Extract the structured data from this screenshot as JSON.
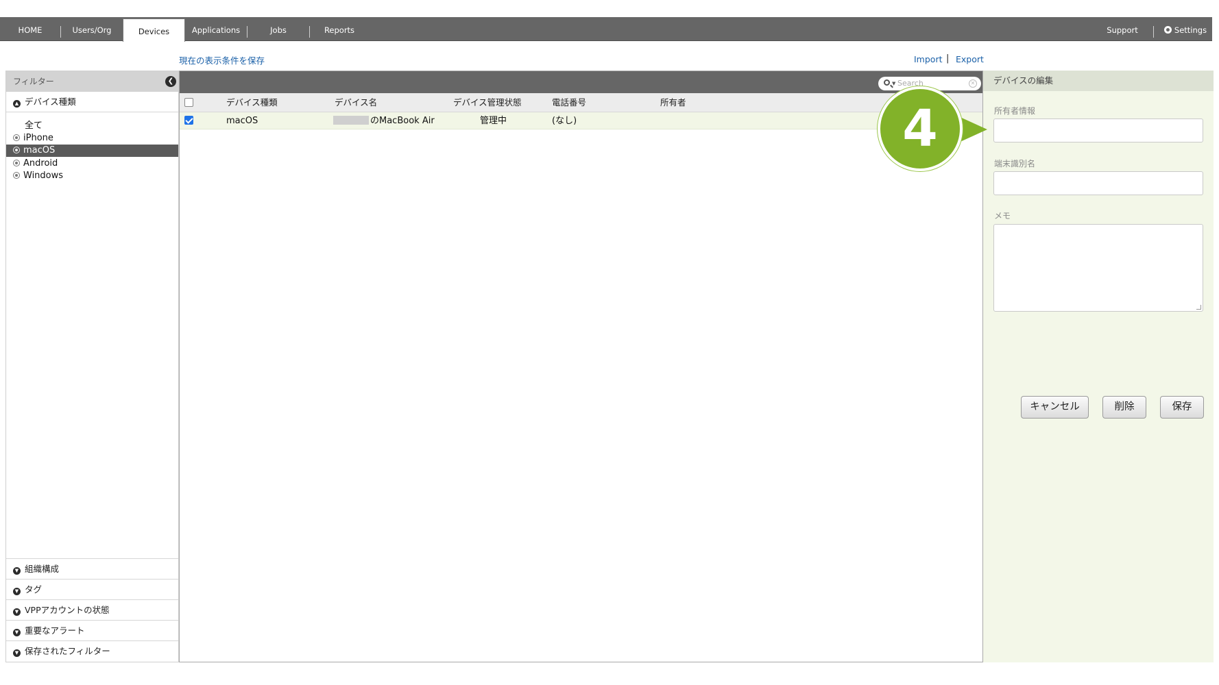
{
  "nav": {
    "items": [
      {
        "label": "HOME"
      },
      {
        "label": "Users/Org"
      },
      {
        "label": "Devices",
        "active": true
      },
      {
        "label": "Applications"
      },
      {
        "label": "Jobs"
      },
      {
        "label": "Reports"
      }
    ],
    "support": "Support",
    "settings": "Settings"
  },
  "links": {
    "save_view": "現在の表示条件を保存",
    "import": "Import",
    "separator": "|",
    "export": "Export"
  },
  "sidebar": {
    "title": "フィルター",
    "device_type_section": "デバイス種類",
    "options": [
      {
        "label": "全て",
        "radio": false
      },
      {
        "label": "iPhone",
        "radio": true
      },
      {
        "label": "macOS",
        "radio": true,
        "selected": true
      },
      {
        "label": "Android",
        "radio": true
      },
      {
        "label": "Windows",
        "radio": true
      }
    ],
    "bottom_sections": [
      {
        "label": "組織構成"
      },
      {
        "label": "タグ"
      },
      {
        "label": "VPPアカウントの状態"
      },
      {
        "label": "重要なアラート"
      },
      {
        "label": "保存されたフィルター"
      }
    ]
  },
  "search": {
    "placeholder": "Search"
  },
  "table": {
    "headers": {
      "type": "デバイス種類",
      "name": "デバイス名",
      "status": "デバイス管理状態",
      "phone": "電話番号",
      "owner": "所有者"
    },
    "rows": [
      {
        "checked": true,
        "type": "macOS",
        "name": "のMacBook Air",
        "status": "管理中",
        "phone": "(なし)",
        "owner": ""
      }
    ]
  },
  "edit": {
    "title": "デバイスの編集",
    "owner_label": "所有者情報",
    "owner_value": "",
    "device_id_label": "端末識別名",
    "device_id_value": "",
    "memo_label": "メモ",
    "memo_value": "",
    "cancel": "キャンセル",
    "delete": "削除",
    "save": "保存"
  },
  "callout": {
    "number": "4"
  },
  "colors": {
    "nav_bg": "#666666",
    "link": "#1a60a8",
    "selected_row": "#f2f6e6",
    "edit_panel": "#f3f7e8",
    "callout": "#82b229",
    "checkbox": "#1f73e8"
  }
}
